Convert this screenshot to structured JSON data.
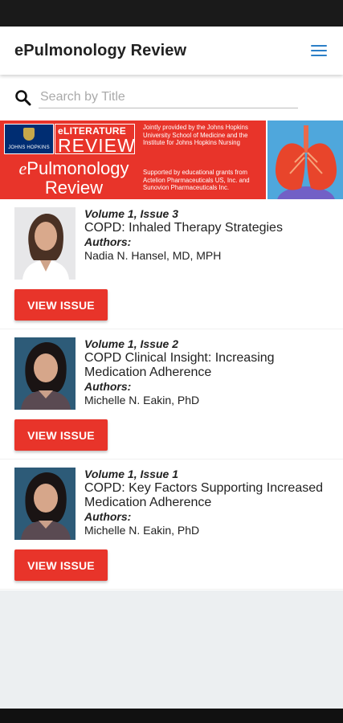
{
  "app": {
    "title": "ePulmonology Review"
  },
  "search": {
    "placeholder": "Search by Title",
    "value": ""
  },
  "banner": {
    "logo_text": "JOHNS HOPKINS",
    "elit_line": "eLITERATURE",
    "elit_review": "REVIEW",
    "title_prefix": "e",
    "title_line1": "Pulmonology",
    "title_line2": "Review",
    "provided_note": "Jointly provided by the Johns Hopkins University School of Medicine and the Institute for Johns Hopkins Nursing",
    "support_note": "Supported by educational grants from Actelion Pharmaceuticals US, Inc. and Sunovion Pharmaceuticals Inc."
  },
  "issues": [
    {
      "volume": "Volume 1, Issue 3",
      "title": "COPD: Inhaled Therapy Strategies",
      "authors_label": "Authors:",
      "author": "Nadia N. Hansel, MD, MPH",
      "button": "VIEW ISSUE"
    },
    {
      "volume": "Volume 1, Issue 2",
      "title": "COPD Clinical Insight: Increasing Medication Adherence",
      "authors_label": "Authors:",
      "author": "Michelle N. Eakin, PhD",
      "button": "VIEW ISSUE"
    },
    {
      "volume": "Volume 1, Issue 1",
      "title": "COPD: Key Factors Supporting Increased Medication Adherence",
      "authors_label": "Authors:",
      "author": "Michelle N. Eakin, PhD",
      "button": "VIEW ISSUE"
    }
  ],
  "colors": {
    "accent_red": "#e8342a",
    "menu_blue": "#2b7fc7"
  },
  "icons": {
    "menu": "hamburger-menu-icon",
    "search": "search-icon"
  }
}
